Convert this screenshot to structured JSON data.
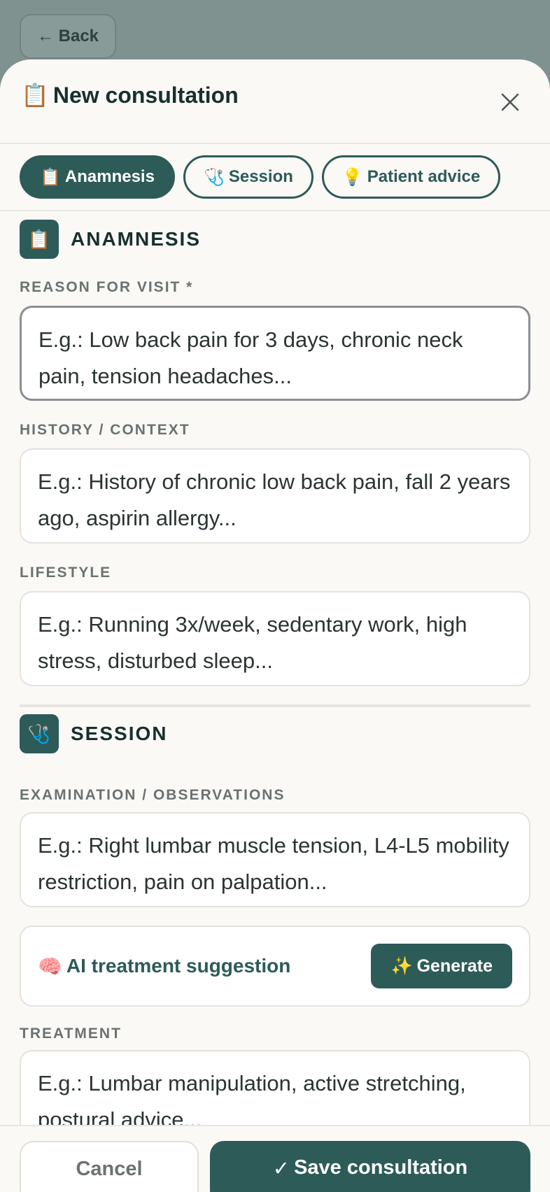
{
  "back_label": "← Back",
  "header": {
    "title_icon": "📋",
    "title": "New consultation"
  },
  "tabs": [
    {
      "icon": "📋",
      "label": "Anamnesis",
      "active": true
    },
    {
      "icon": "🩺",
      "label": "Session",
      "active": false
    },
    {
      "icon": "💡",
      "label": "Patient advice",
      "active": false
    }
  ],
  "anamnesis": {
    "icon": "📋",
    "title": "ANAMNESIS",
    "reason": {
      "label": "REASON FOR VISIT *",
      "placeholder": "E.g.: Low back pain for 3 days, chronic neck pain, tension headaches..."
    },
    "history": {
      "label": "HISTORY / CONTEXT",
      "placeholder": "E.g.: History of chronic low back pain, fall 2 years ago, aspirin allergy..."
    },
    "lifestyle": {
      "label": "LIFESTYLE",
      "placeholder": "E.g.: Running 3x/week, sedentary work, high stress, disturbed sleep..."
    }
  },
  "session": {
    "icon": "🩺",
    "title": "SESSION",
    "examination": {
      "label": "EXAMINATION / OBSERVATIONS",
      "placeholder": "E.g.: Right lumbar muscle tension, L4-L5 mobility restriction, pain on palpation..."
    },
    "ai": {
      "icon": "🧠",
      "label": "AI treatment suggestion",
      "button_icon": "✨",
      "button_label": "Generate"
    },
    "treatment": {
      "label": "TREATMENT",
      "placeholder": "E.g.: Lumbar manipulation, active stretching, postural advice..."
    }
  },
  "footer": {
    "cancel_label": "Cancel",
    "save_icon": "✓",
    "save_label": "Save consultation"
  },
  "colors": {
    "primary": "#2d5b58",
    "sheet": "#faf9f6",
    "overlay": "#7f9290"
  }
}
